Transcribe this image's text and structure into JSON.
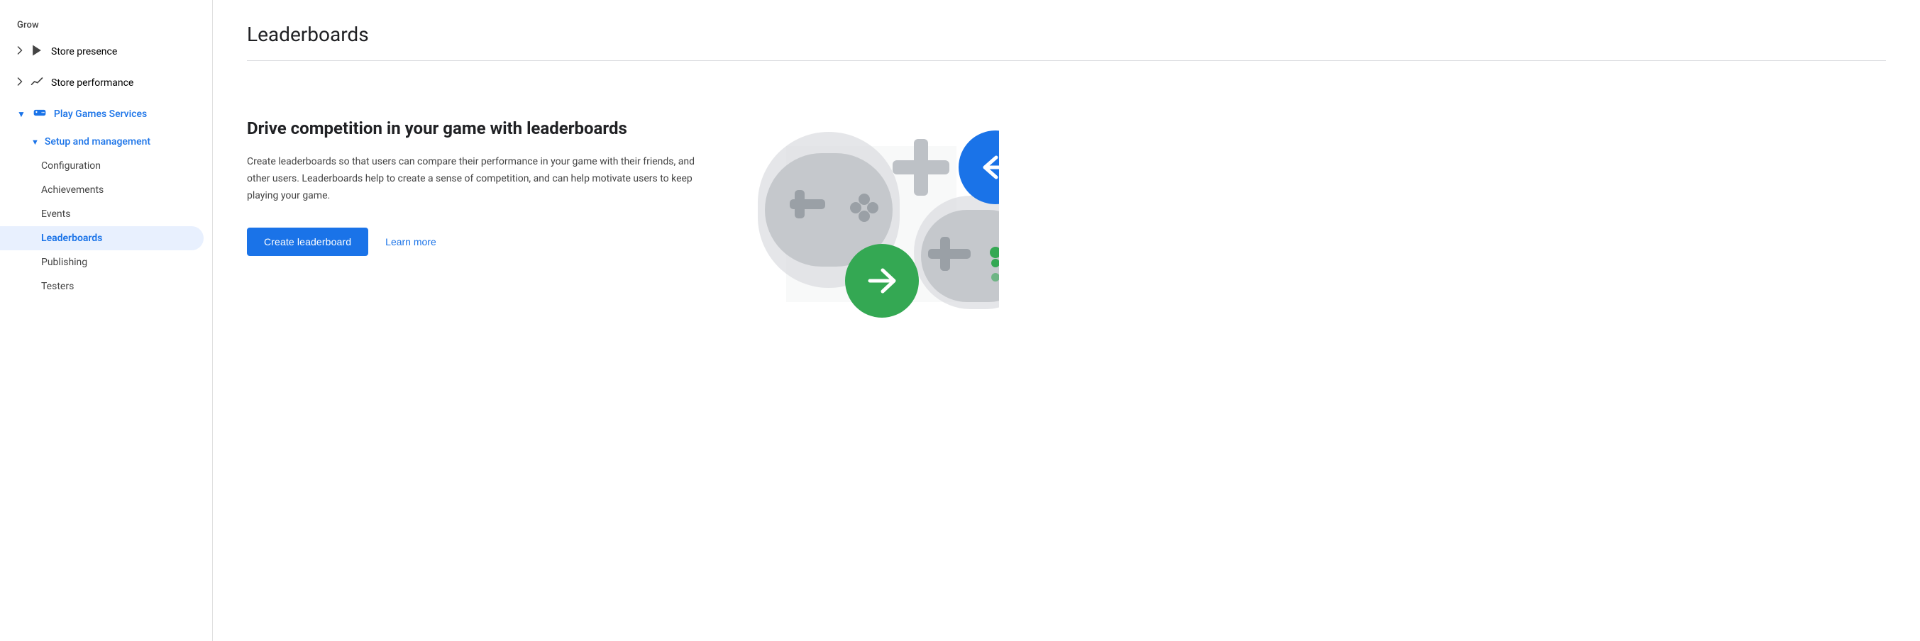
{
  "sidebar": {
    "grow_label": "Grow",
    "items": [
      {
        "id": "store-presence",
        "label": "Store presence",
        "icon": "play-icon",
        "expandable": true,
        "expanded": false,
        "indent": 0
      },
      {
        "id": "store-performance",
        "label": "Store performance",
        "icon": "chart-icon",
        "expandable": true,
        "expanded": false,
        "indent": 0
      },
      {
        "id": "play-games-services",
        "label": "Play Games Services",
        "icon": "gamepad-icon",
        "expandable": true,
        "expanded": true,
        "indent": 0,
        "blue": true
      },
      {
        "id": "setup-management",
        "label": "Setup and management",
        "expandable": true,
        "expanded": true,
        "indent": 1,
        "blue": true
      },
      {
        "id": "configuration",
        "label": "Configuration",
        "indent": 2
      },
      {
        "id": "achievements",
        "label": "Achievements",
        "indent": 2
      },
      {
        "id": "events",
        "label": "Events",
        "indent": 2
      },
      {
        "id": "leaderboards",
        "label": "Leaderboards",
        "indent": 2,
        "active": true
      },
      {
        "id": "publishing",
        "label": "Publishing",
        "indent": 2
      },
      {
        "id": "testers",
        "label": "Testers",
        "indent": 2
      }
    ]
  },
  "main": {
    "title": "Leaderboards",
    "headline": "Drive competition in your game with leaderboards",
    "body": "Create leaderboards so that users can compare their performance in your game with their friends, and other users. Leaderboards help to create a sense of competition, and can help motivate users to keep playing your game.",
    "create_button_label": "Create leaderboard",
    "learn_more_label": "Learn more"
  },
  "colors": {
    "blue": "#1a73e8",
    "green": "#34a853",
    "yellow": "#fbbc04",
    "controller_bg": "#dadce0",
    "controller_dark": "#bdc1c6"
  }
}
